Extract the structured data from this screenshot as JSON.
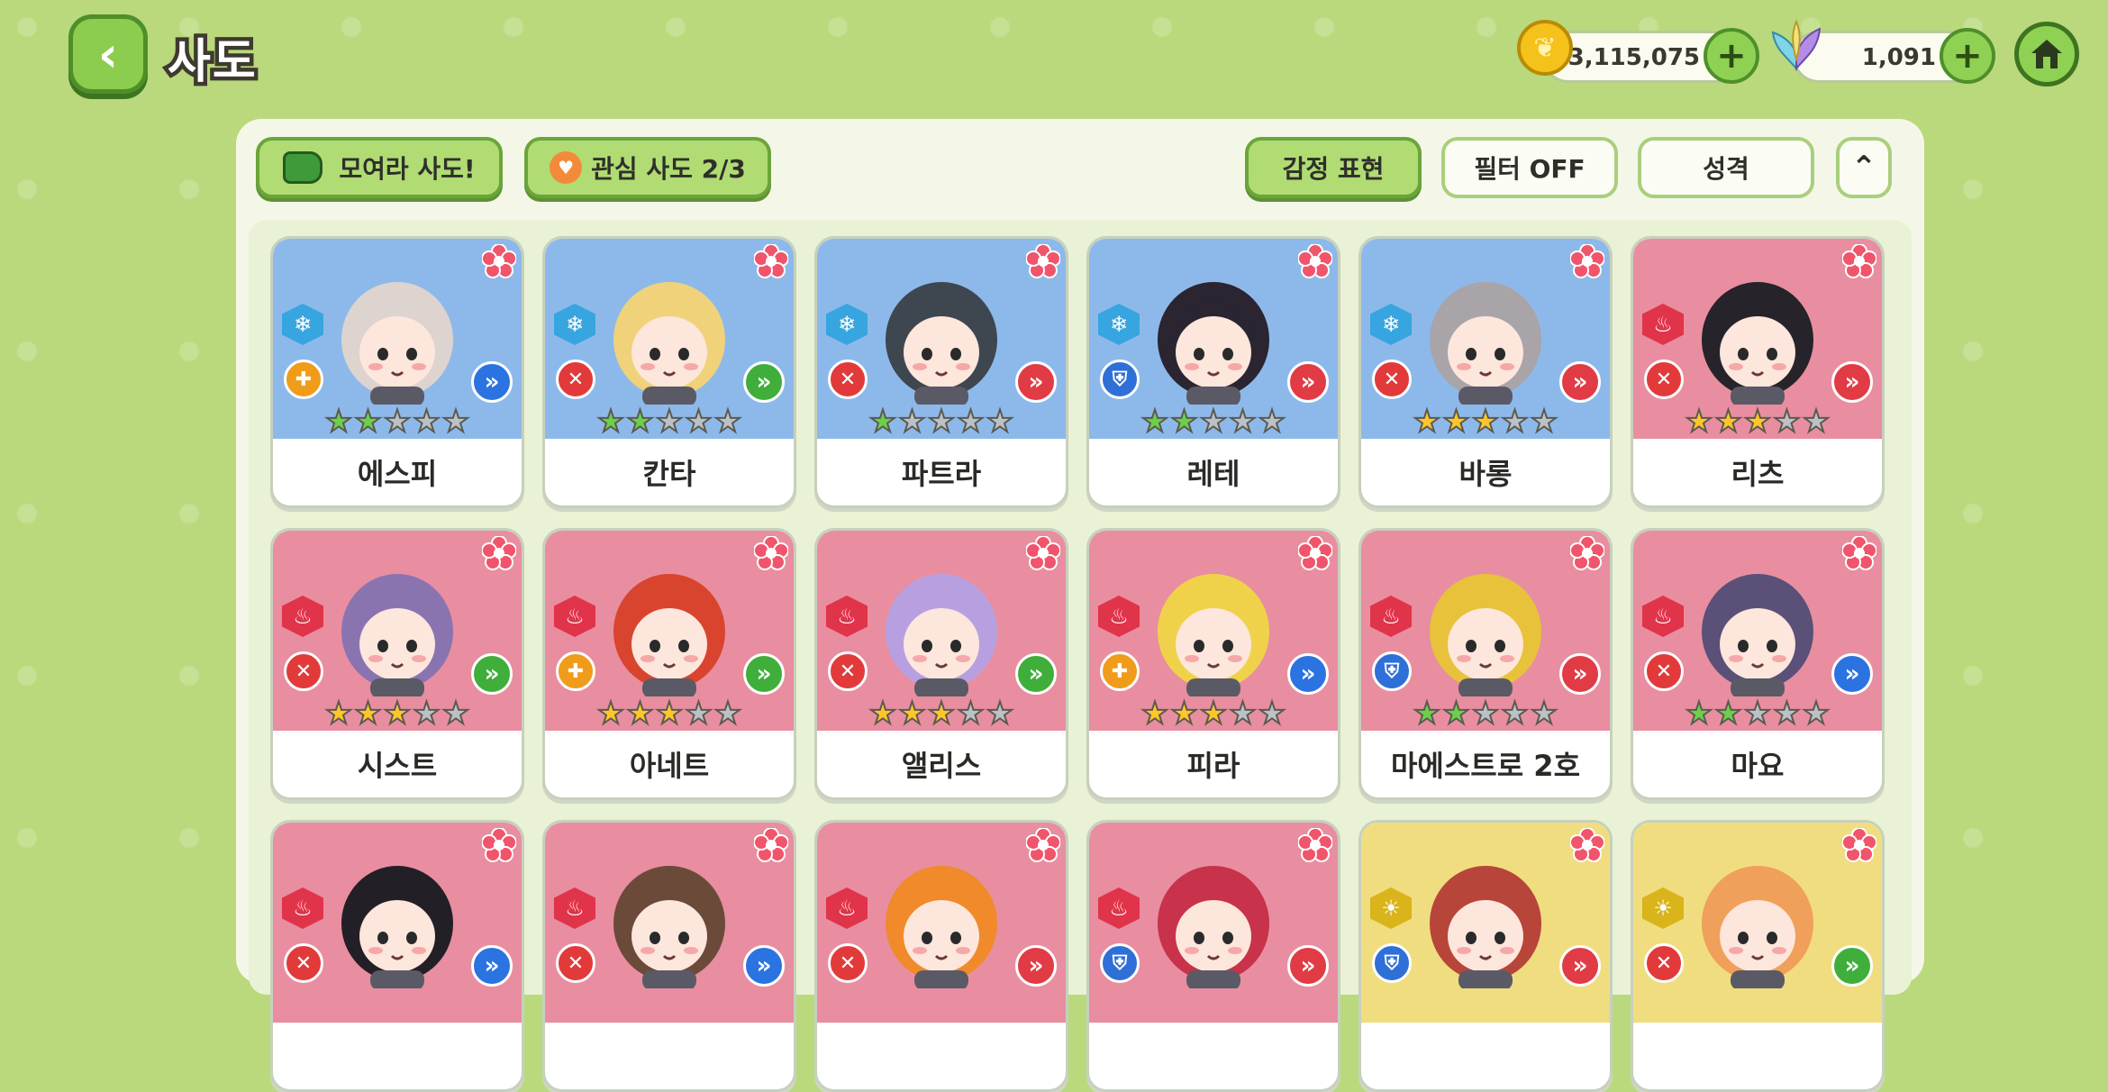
{
  "header": {
    "back_label": "‹",
    "title": "사도",
    "gold": "3,115,075",
    "gems": "1,091",
    "plus": "+"
  },
  "toolbar": {
    "gather_label": "모여라 사도!",
    "favorite_label": "관심 사도  2/3",
    "emotion_label": "감정 표현",
    "filter_label": "필터 OFF",
    "personality_label": "성격",
    "collapse_label": "⌃"
  },
  "colors": {
    "background": "#b9d97c",
    "panel": "#f4f7e8",
    "accent_green": "#8fd153",
    "card_blue": "#8db9ea",
    "card_red": "#e88ea0",
    "card_yellow": "#f0dd80"
  },
  "cards": [
    {
      "name": "에스피",
      "bg": "blue",
      "element": "ice",
      "role": "heal",
      "cls": "b",
      "stars": 2,
      "star_color": "green",
      "hair": "#ddd4cf"
    },
    {
      "name": "칸타",
      "bg": "blue",
      "element": "ice",
      "role": "atk",
      "cls": "g",
      "stars": 2,
      "star_color": "green",
      "hair": "#f0d27a"
    },
    {
      "name": "파트라",
      "bg": "blue",
      "element": "ice",
      "role": "atk",
      "cls": "r",
      "stars": 1,
      "star_color": "green",
      "hair": "#3e4650"
    },
    {
      "name": "레테",
      "bg": "blue",
      "element": "ice",
      "role": "tank",
      "cls": "r",
      "stars": 2,
      "star_color": "green",
      "hair": "#2a2530"
    },
    {
      "name": "바롱",
      "bg": "blue",
      "element": "ice",
      "role": "atk",
      "cls": "r",
      "stars": 3,
      "star_color": "gold",
      "hair": "#a8a4a8"
    },
    {
      "name": "리츠",
      "bg": "red",
      "element": "fire",
      "role": "atk",
      "cls": "r",
      "stars": 3,
      "star_color": "gold",
      "hair": "#26232a"
    },
    {
      "name": "시스트",
      "bg": "red",
      "element": "fire",
      "role": "atk",
      "cls": "g",
      "stars": 3,
      "star_color": "gold",
      "hair": "#8a74b0"
    },
    {
      "name": "아네트",
      "bg": "red",
      "element": "fire",
      "role": "heal",
      "cls": "g",
      "stars": 3,
      "star_color": "gold",
      "hair": "#d9442e"
    },
    {
      "name": "앨리스",
      "bg": "red",
      "element": "fire",
      "role": "atk",
      "cls": "g",
      "stars": 3,
      "star_color": "gold",
      "hair": "#b8a0e0"
    },
    {
      "name": "피라",
      "bg": "red",
      "element": "fire",
      "role": "heal",
      "cls": "b",
      "stars": 3,
      "star_color": "gold",
      "hair": "#f0d24a"
    },
    {
      "name": "마에스트로 2호",
      "bg": "red",
      "element": "fire",
      "role": "tank",
      "cls": "r",
      "stars": 2,
      "star_color": "green",
      "hair": "#e8c23a"
    },
    {
      "name": "마요",
      "bg": "red",
      "element": "fire",
      "role": "atk",
      "cls": "b",
      "stars": 2,
      "star_color": "green",
      "hair": "#5a5078"
    },
    {
      "name": "",
      "bg": "red",
      "element": "fire",
      "role": "atk",
      "cls": "b",
      "stars": 0,
      "star_color": "gold",
      "hair": "#222026"
    },
    {
      "name": "",
      "bg": "red",
      "element": "fire",
      "role": "atk",
      "cls": "b",
      "stars": 0,
      "star_color": "gold",
      "hair": "#6b4a3a"
    },
    {
      "name": "",
      "bg": "red",
      "element": "fire",
      "role": "atk",
      "cls": "r",
      "stars": 0,
      "star_color": "gold",
      "hair": "#f08a2a"
    },
    {
      "name": "",
      "bg": "red",
      "element": "fire",
      "role": "tank",
      "cls": "r",
      "stars": 0,
      "star_color": "gold",
      "hair": "#c8324a"
    },
    {
      "name": "",
      "bg": "yellow",
      "element": "light",
      "role": "tank",
      "cls": "r",
      "stars": 0,
      "star_color": "gold",
      "hair": "#b8453a"
    },
    {
      "name": "",
      "bg": "yellow",
      "element": "light",
      "role": "atk",
      "cls": "g",
      "stars": 0,
      "star_color": "gold",
      "hair": "#f0a05a"
    }
  ]
}
